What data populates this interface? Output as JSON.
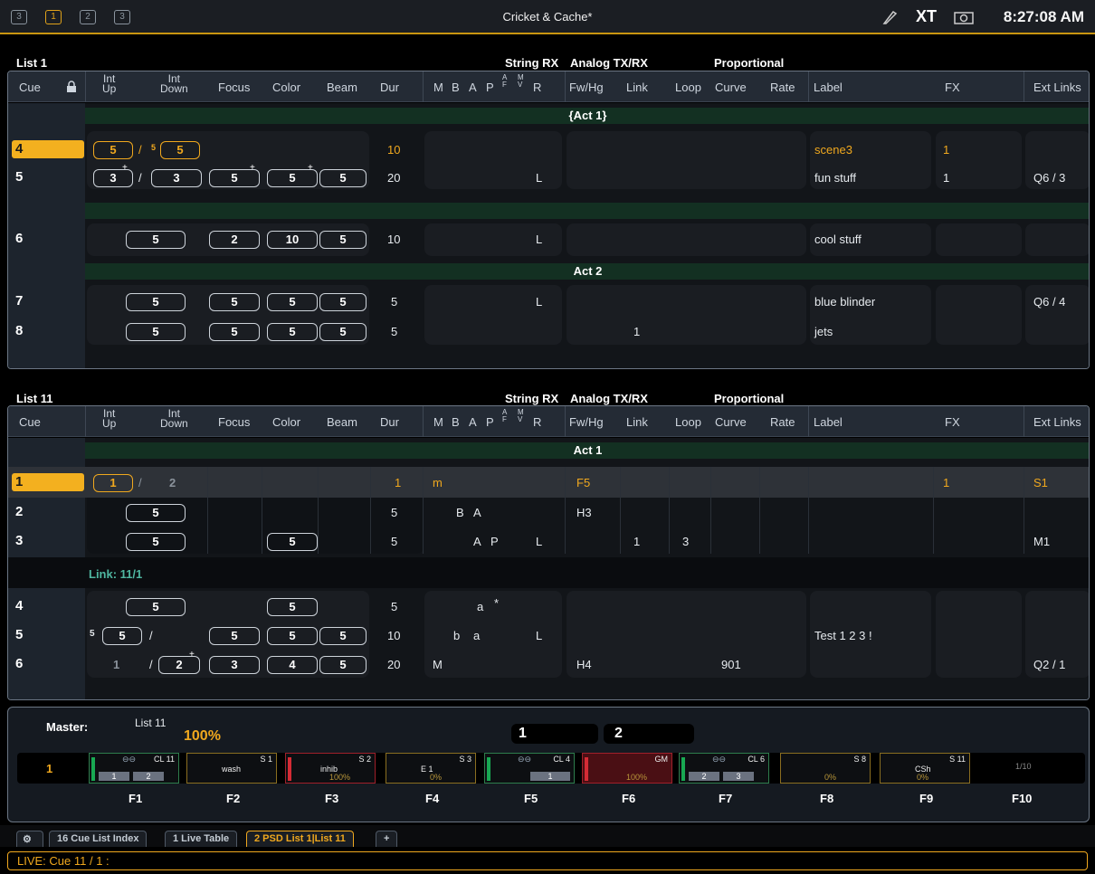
{
  "topbar": {
    "icons": [
      "monitor-icon",
      "page-1-icon",
      "page-2-icon",
      "page-3-icon"
    ],
    "page_labels": [
      "3",
      "1",
      "2",
      "3"
    ],
    "title": "Cricket & Cache*",
    "clock": "8:27:08 AM",
    "accent": "#c99510"
  },
  "headers": {
    "cue": "Cue",
    "int_up": "Int\nUp",
    "int_down": "Int\nDown",
    "focus": "Focus",
    "color": "Color",
    "beam": "Beam",
    "dur": "Dur",
    "m": "M",
    "b": "B",
    "a": "A",
    "p": "P",
    "af_top": "A",
    "af_bot": "F",
    "mv_top": "M",
    "mv_bot": "V",
    "r": "R",
    "fwhg": "Fw/Hg",
    "link": "Link",
    "loop": "Loop",
    "curve": "Curve",
    "rate": "Rate",
    "label": "Label",
    "fx": "FX",
    "ext": "Ext Links",
    "grp_string": "String RX",
    "grp_analog": "Analog TX/RX",
    "grp_prop": "Proportional"
  },
  "list1": {
    "title": "List 1",
    "parts": [
      "{Act 1}",
      "",
      "Act 2"
    ],
    "cues": [
      {
        "num": "4",
        "up": "5",
        "down": "5",
        "dn_pre": "5",
        "dur": "10",
        "label": "scene3",
        "fx": "1",
        "ext": ""
      },
      {
        "num": "5",
        "up": "3",
        "down": "3",
        "focus": "5",
        "color": "5",
        "beam": "5",
        "dur": "20",
        "r": "L",
        "label": "fun stuff",
        "fx": "1",
        "ext": "Q6 / 3"
      },
      {
        "num": "6",
        "down": "5",
        "focus": "2",
        "color": "10",
        "beam": "5",
        "dur": "10",
        "r": "L",
        "label": "cool stuff"
      },
      {
        "num": "7",
        "down": "5",
        "focus": "5",
        "color": "5",
        "beam": "5",
        "dur": "5",
        "r": "L",
        "label": "blue blinder",
        "ext": "Q6 / 4"
      },
      {
        "num": "8",
        "down": "5",
        "focus": "5",
        "color": "5",
        "beam": "5",
        "dur": "5",
        "link": "1",
        "label": "jets"
      }
    ]
  },
  "list11": {
    "title": "List 11",
    "parts": [
      "Act 1"
    ],
    "link_note": "Link: 11/1",
    "cues": [
      {
        "num": "1",
        "up": "1",
        "down": "2",
        "dur": "1",
        "m": "m",
        "fwhg": "F5",
        "fx": "1",
        "ext": "S1"
      },
      {
        "num": "2",
        "down": "5",
        "dur": "5",
        "b": "B",
        "a": "A",
        "fwhg": "H3"
      },
      {
        "num": "3",
        "down": "5",
        "color": "5",
        "dur": "5",
        "a": "A",
        "p": "P",
        "r": "L",
        "link": "1",
        "loop": "3",
        "ext": "M1"
      },
      {
        "num": "4",
        "down": "5",
        "color": "5",
        "dur": "5",
        "a": "a",
        "p": "*"
      },
      {
        "num": "5",
        "up_pre": "5",
        "up": "5",
        "focus": "5",
        "color": "5",
        "beam": "5",
        "dur": "10",
        "b": "b",
        "a": "a",
        "r": "L",
        "label": "Test 1 2 3 !"
      },
      {
        "num": "6",
        "up": "1",
        "down": "2",
        "focus": "3",
        "color": "4",
        "beam": "5",
        "dur": "20",
        "m": "M",
        "fwhg": "H4",
        "curve": "901",
        "ext": "Q2 / 1"
      }
    ]
  },
  "master": {
    "label": "Master:",
    "list": "List 11",
    "level": "100%",
    "page": "1",
    "cue_boxes": [
      "1",
      "2"
    ],
    "page_count": "1/10",
    "faders": [
      {
        "key": "F1",
        "top": "CL 11",
        "mid": "",
        "pages": [
          "1",
          "2"
        ],
        "pct": ""
      },
      {
        "key": "F2",
        "top": "S 1",
        "mid": "wash",
        "pages": [],
        "pct": ""
      },
      {
        "key": "F3",
        "top": "S 2",
        "mid": "inhib",
        "pages": [],
        "pct": "100%"
      },
      {
        "key": "F4",
        "top": "S 3",
        "mid": "E 1",
        "pages": [],
        "pct": "0%"
      },
      {
        "key": "F5",
        "top": "CL 4",
        "mid": "",
        "pages": [
          "1"
        ],
        "pct": ""
      },
      {
        "key": "F6",
        "top": "GM",
        "mid": "",
        "pages": [],
        "pct": "100%"
      },
      {
        "key": "F7",
        "top": "CL 6",
        "mid": "",
        "pages": [
          "2",
          "3"
        ],
        "pct": ""
      },
      {
        "key": "F8",
        "top": "S 8",
        "mid": "",
        "pages": [],
        "pct": "0%"
      },
      {
        "key": "F9",
        "top": "S 11",
        "mid": "CSh",
        "pages": [],
        "pct": "0%"
      },
      {
        "key": "F10",
        "top": "",
        "mid": "",
        "pages": [],
        "pct": ""
      }
    ]
  },
  "tabs": [
    "16 Cue List Index",
    "1 Live Table",
    "2 PSD List 1|List 11",
    "+"
  ],
  "command_line": "LIVE: Cue  11 / 1 :"
}
